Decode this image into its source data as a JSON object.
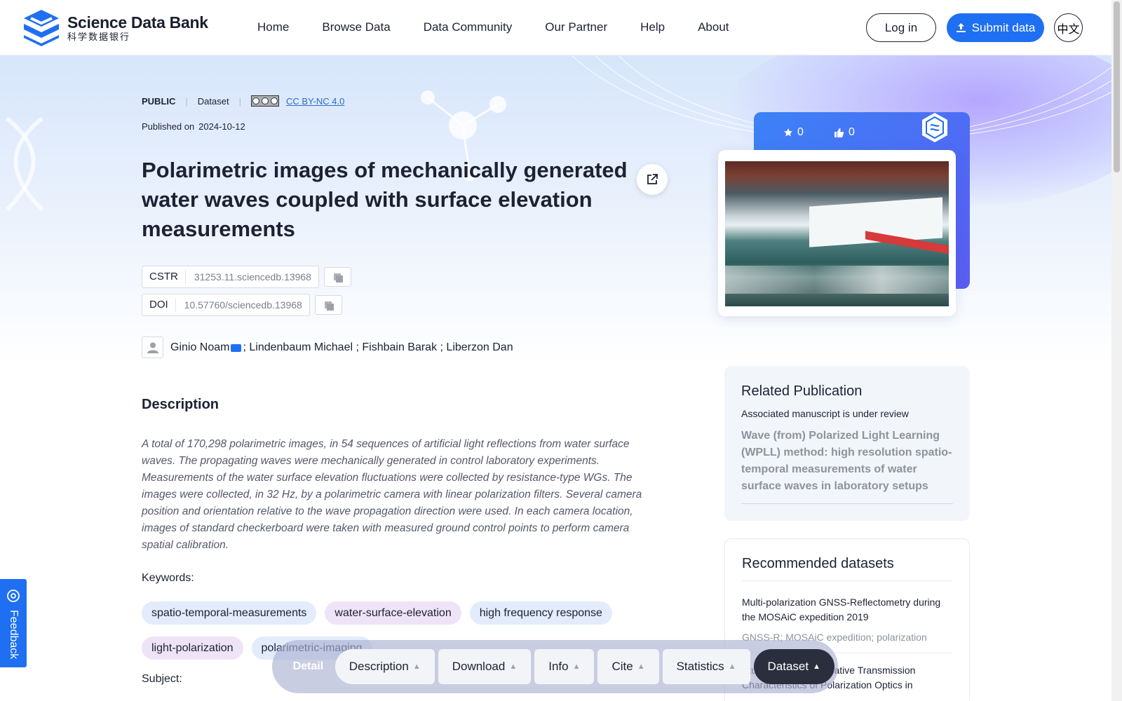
{
  "header": {
    "logo_en": "Science Data Bank",
    "logo_cn": "科学数据银行",
    "nav": [
      "Home",
      "Browse Data",
      "Data Community",
      "Our Partner",
      "Help",
      "About"
    ],
    "login": "Log in",
    "submit": "Submit data",
    "lang": "中文"
  },
  "dataset": {
    "access": "PUBLIC",
    "type": "Dataset",
    "license": "CC BY-NC 4.0",
    "published_label": "Published on",
    "published_date": "2024-10-12",
    "title": "Polarimetric images of mechanically generated water waves coupled with surface elevation measurements",
    "cstr_label": "CSTR",
    "cstr": "31253.11.sciencedb.13968",
    "doi_label": "DOI",
    "doi": "10.57760/sciencedb.13968",
    "author_first": "Ginio Noam",
    "authors_rest": "; Lindenbaum Michael ; Fishbain Barak ; Liberzon Dan",
    "description_title": "Description",
    "description": "A total of 170,298 polarimetric images, in 54 sequences of artificial light reflections from water surface waves. The propagating waves were mechanically generated in control laboratory experiments. Measurements of the water surface elevation fluctuations were collected by resistance-type WGs. The images were collected, in 32 Hz, by a polarimetric camera with linear polarization filters. Several camera position and orientation relative to the wave propagation direction were used. In each camera location, images of standard checkerboard were taken with measured ground control points to perform camera spatial calibration.",
    "keywords_label": "Keywords:",
    "keywords": [
      "spatio-temporal-measurements",
      "water-surface-elevation",
      "high frequency response",
      "light-polarization",
      "polarimetric-imaging"
    ],
    "subject_label": "Subject:"
  },
  "stats": {
    "stars": "0",
    "likes": "0"
  },
  "related": {
    "title": "Related Publication",
    "status": "Associated manuscript is under review",
    "publication": "Wave (from) Polarized Light Learning (WPLL) method: high resolution spatio-temporal measurements of water surface waves in laboratory setups"
  },
  "recommended": {
    "title": "Recommended datasets",
    "items": [
      {
        "title": "Multi-polarization GNSS-Reflectometry during the MOSAiC expedition 2019",
        "tags": "GNSS-R; MOSAiC expedition; polarization"
      },
      {
        "title": "Study on Vector Radiative Transmission Characteristics of Polarization Optics in",
        "tags": ""
      }
    ]
  },
  "feedback": "Feedback",
  "bottom_bar": {
    "detail": "Detail",
    "tabs": [
      "Description",
      "Download",
      "Info",
      "Cite",
      "Statistics",
      "Dataset"
    ]
  },
  "colors": {
    "primary": "#1f6ff2",
    "dark": "#2b2f3d",
    "text": "#1c2233"
  }
}
